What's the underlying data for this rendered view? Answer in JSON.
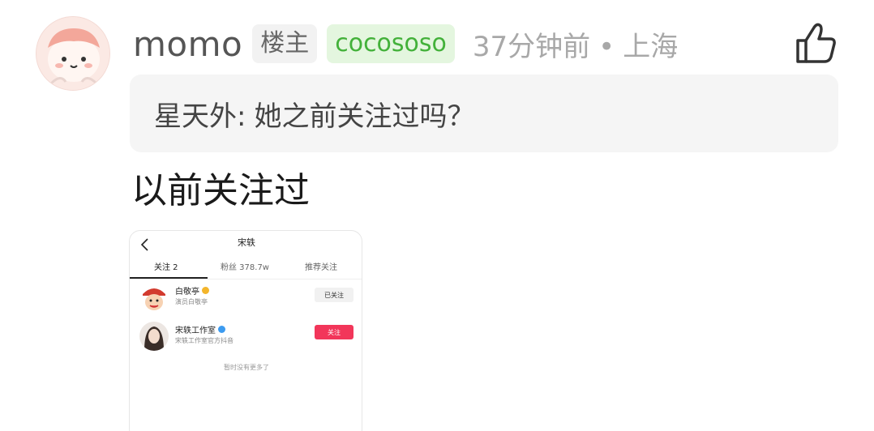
{
  "comment": {
    "username": "momo",
    "op_badge": "楼主",
    "tag_badge": "cocososo",
    "time": "37分钟前",
    "separator": "•",
    "location": "上海",
    "quote_author": "星天外:",
    "quote_text": "她之前关注过吗？",
    "text": "以前关注过",
    "like_icon": "thumbs-up-icon"
  },
  "embedded": {
    "title": "宋轶",
    "tabs": [
      {
        "label": "关注 2"
      },
      {
        "label": "粉丝 378.7w"
      },
      {
        "label": "推荐关注"
      }
    ],
    "users": [
      {
        "name": "白敬亭",
        "desc": "演员白敬亭",
        "button": "已关注",
        "verify_color": "#f3b52b"
      },
      {
        "name": "宋轶工作室",
        "desc": "宋轶工作室官方抖音",
        "button": "关注",
        "verify_color": "#3c9bf0"
      }
    ],
    "no_more": "暂时没有更多了"
  },
  "colors": {
    "accent_green": "#43b13a",
    "follow_red": "#f2365a"
  }
}
